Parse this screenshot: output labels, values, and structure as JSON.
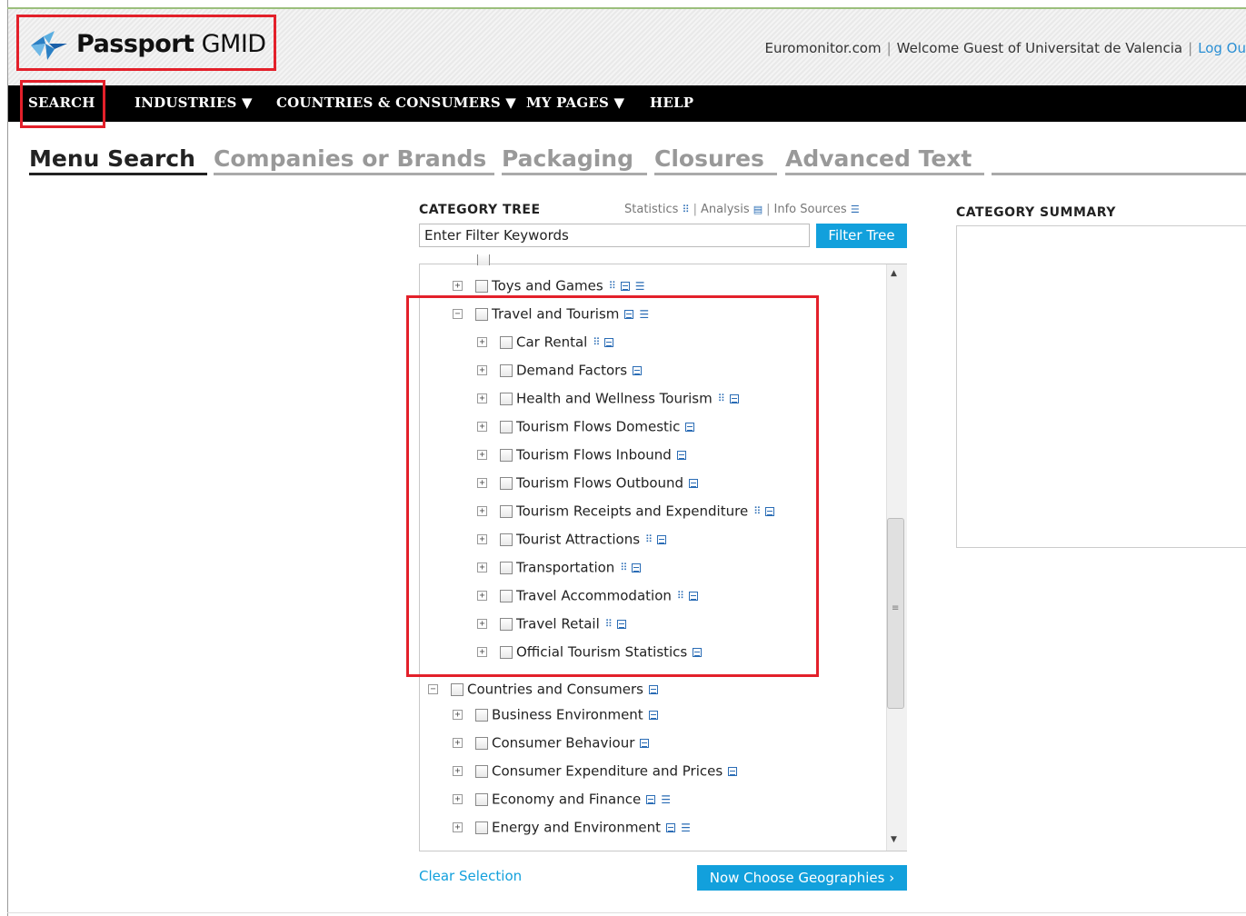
{
  "header": {
    "brand_bold": "Passport",
    "brand_light": "GMID",
    "links": {
      "site": "Euromonitor.com",
      "welcome": "Welcome Guest of Universitat de Valencia",
      "logout": "Log Ou"
    }
  },
  "nav": {
    "items": [
      {
        "label": "SEARCH"
      },
      {
        "label": "INDUSTRIES ▼"
      },
      {
        "label": "COUNTRIES & CONSUMERS ▼"
      },
      {
        "label": "MY PAGES ▼"
      },
      {
        "label": "HELP"
      }
    ]
  },
  "tabs": [
    {
      "label": "Menu Search",
      "active": true
    },
    {
      "label": "Companies or Brands"
    },
    {
      "label": "Packaging"
    },
    {
      "label": "Closures"
    },
    {
      "label": "Advanced Text"
    }
  ],
  "category_tree": {
    "title": "CATEGORY TREE",
    "tools": {
      "statistics": "Statistics",
      "analysis": "Analysis",
      "info_sources": "Info Sources"
    },
    "filter_placeholder": "Enter Filter Keywords",
    "filter_button": "Filter Tree",
    "rows": [
      {
        "label": "Toys and Games",
        "expander": "+",
        "icons": [
          "stat",
          "ana",
          "info"
        ]
      },
      {
        "label": "Travel and Tourism",
        "expander": "−",
        "icons": [
          "ana",
          "info"
        ]
      },
      {
        "label": "Car Rental",
        "expander": "+",
        "icons": [
          "stat",
          "ana"
        ]
      },
      {
        "label": "Demand Factors",
        "expander": "+",
        "icons": [
          "ana"
        ]
      },
      {
        "label": "Health and Wellness Tourism",
        "expander": "+",
        "icons": [
          "stat",
          "ana"
        ]
      },
      {
        "label": "Tourism Flows Domestic",
        "expander": "+",
        "icons": [
          "ana"
        ]
      },
      {
        "label": "Tourism Flows Inbound",
        "expander": "+",
        "icons": [
          "ana"
        ]
      },
      {
        "label": "Tourism Flows Outbound",
        "expander": "+",
        "icons": [
          "ana"
        ]
      },
      {
        "label": "Tourism Receipts and Expenditure",
        "expander": "+",
        "icons": [
          "stat",
          "ana"
        ]
      },
      {
        "label": "Tourist Attractions",
        "expander": "+",
        "icons": [
          "stat",
          "ana"
        ]
      },
      {
        "label": "Transportation",
        "expander": "+",
        "icons": [
          "stat",
          "ana"
        ]
      },
      {
        "label": "Travel Accommodation",
        "expander": "+",
        "icons": [
          "stat",
          "ana"
        ]
      },
      {
        "label": "Travel Retail",
        "expander": "+",
        "icons": [
          "stat",
          "ana"
        ]
      },
      {
        "label": "Official Tourism Statistics",
        "expander": "+",
        "icons": [
          "ana"
        ]
      },
      {
        "label": "Countries and Consumers",
        "expander": "−",
        "icons": [
          "ana"
        ]
      },
      {
        "label": "Business Environment",
        "expander": "+",
        "icons": [
          "ana"
        ]
      },
      {
        "label": "Consumer Behaviour",
        "expander": "+",
        "icons": [
          "ana"
        ]
      },
      {
        "label": "Consumer Expenditure and Prices",
        "expander": "+",
        "icons": [
          "ana"
        ]
      },
      {
        "label": "Economy and Finance",
        "expander": "+",
        "icons": [
          "ana",
          "info"
        ]
      },
      {
        "label": "Energy and Environment",
        "expander": "+",
        "icons": [
          "ana",
          "info"
        ]
      }
    ],
    "clear_selection": "Clear Selection",
    "next_button": "Now Choose Geographies ›"
  },
  "category_summary": {
    "title": "CATEGORY SUMMARY"
  },
  "colors": {
    "accent_blue": "#12a0dc",
    "highlight_red": "#e3202a",
    "nav_bg": "#000000"
  }
}
